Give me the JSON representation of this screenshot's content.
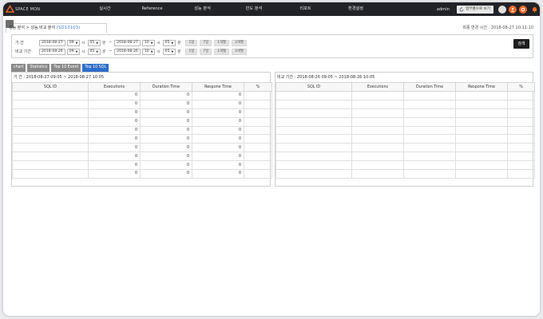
{
  "brand": {
    "logo_text": "SPACE MON",
    "accent": "#ef6a2a"
  },
  "nav": {
    "items": [
      "실시간",
      "Reference",
      "성능 분석",
      "빈도 분석",
      "리포트",
      "환경설정"
    ]
  },
  "user": {
    "name": "admin",
    "mode_button": "업무별으로 보기"
  },
  "breadcrumb": {
    "path": "성능 분석 > 성능 비교 분석",
    "code": "(SD13103)"
  },
  "last_change": "최종 변경 시간 : 2018-08-27 10:11:10",
  "filter": {
    "period_label": "기    간",
    "compare_label": "비교 기간",
    "hour_unit": "시",
    "minute_unit": "분",
    "tilde": "~",
    "period": {
      "from_date": "2018-08-27",
      "from_hour": "09",
      "from_min": "05",
      "to_date": "2018-08-27",
      "to_hour": "10",
      "to_min": "05"
    },
    "compare": {
      "from_date": "2018-08-26",
      "from_hour": "09",
      "from_min": "05",
      "to_date": "2018-08-26",
      "to_hour": "10",
      "to_min": "05"
    },
    "quick": [
      "1일",
      "7일",
      "1개월",
      "3개월"
    ],
    "search_label": "검색"
  },
  "tabs": [
    "chart",
    "Statistics",
    "Top 10 Event",
    "Top 10 SQL"
  ],
  "active_tab": "Top 10 SQL",
  "left_panel": {
    "title": "기     간 : 2018-08-27 09:05 ~ 2018-08-27 10:05",
    "columns": [
      "SQL ID",
      "Executions",
      "Duration Time",
      "Respone Time",
      "%"
    ],
    "rows": [
      [
        "",
        "0",
        "0",
        "0",
        ""
      ],
      [
        "",
        "0",
        "0",
        "0",
        ""
      ],
      [
        "",
        "0",
        "0",
        "0",
        ""
      ],
      [
        "",
        "0",
        "0",
        "0",
        ""
      ],
      [
        "",
        "0",
        "0",
        "0",
        ""
      ],
      [
        "",
        "0",
        "0",
        "0",
        ""
      ],
      [
        "",
        "0",
        "0",
        "0",
        ""
      ],
      [
        "",
        "0",
        "0",
        "0",
        ""
      ],
      [
        "",
        "0",
        "0",
        "0",
        ""
      ],
      [
        "",
        "0",
        "0",
        "0",
        ""
      ]
    ]
  },
  "right_panel": {
    "title": "비교 기간 : 2018-08-26 09:05 ~ 2018-08-26 10:05",
    "columns": [
      "SQL ID",
      "Executions",
      "Duration Time",
      "Respone Time",
      "%"
    ],
    "rows": [
      [
        "",
        "",
        "",
        "",
        ""
      ],
      [
        "",
        "",
        "",
        "",
        ""
      ],
      [
        "",
        "",
        "",
        "",
        ""
      ],
      [
        "",
        "",
        "",
        "",
        ""
      ],
      [
        "",
        "",
        "",
        "",
        ""
      ],
      [
        "",
        "",
        "",
        "",
        ""
      ],
      [
        "",
        "",
        "",
        "",
        ""
      ],
      [
        "",
        "",
        "",
        "",
        ""
      ],
      [
        "",
        "",
        "",
        "",
        ""
      ],
      [
        "",
        "",
        "",
        "",
        ""
      ]
    ]
  }
}
